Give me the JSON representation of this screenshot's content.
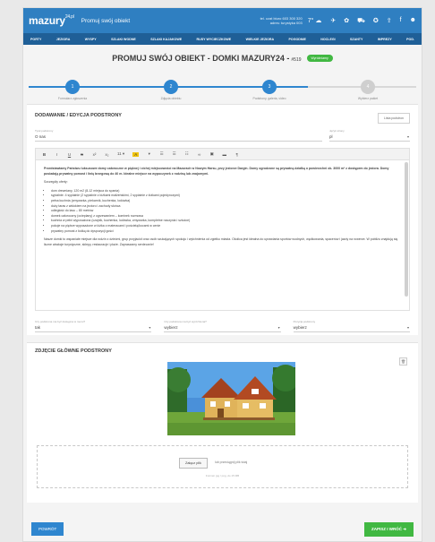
{
  "header": {
    "logo": "mazury",
    "logo_suffix": "24.pl",
    "tagline": "Promuj swój obiekt",
    "contact_line1": "tel. czat biuro 603 300 320",
    "contact_line2": "adres: turystyka 003",
    "weather": "7° ☁",
    "icons": [
      "plane-icon",
      "paw-icon",
      "car-icon",
      "settings-icon",
      "share-icon",
      "facebook-icon",
      "user-icon"
    ]
  },
  "nav": [
    "PORTY",
    "JEZIORA",
    "WYSPY",
    "SZLAKI WODNE",
    "SZLAKI KAJAKOWE",
    "RUSY WYCIECZKOWE",
    "WIELKIE JEZIORA",
    "POGODNIE",
    "NOCLEGI",
    "SZANTY",
    "IMPREZY",
    "POD."
  ],
  "page": {
    "title": "PROMUJ SWÓJ OBIEKT - DOMKI MAZURY24 -",
    "id": "#519",
    "badge": "Wyróżniamy"
  },
  "steps": [
    {
      "number": "1",
      "label": "Formularz zgłoszenia",
      "active": true
    },
    {
      "number": "2",
      "label": "Zdjęcia obiektu",
      "active": true
    },
    {
      "number": "3",
      "label": "Podstrony, galeria, video",
      "active": true
    },
    {
      "number": "4",
      "label": "Wybierz pakiet",
      "active": false
    }
  ],
  "progress": 0.72,
  "section1": {
    "title": "DODAWANIE / EDYCJA PODSTRONY",
    "list_button": "Lista podstron",
    "title_field_label": "Tytuł podstrony",
    "title_field_value": "O nas",
    "lang_label": "Język strony",
    "lang_value": "pl",
    "toolbar": [
      "B",
      "I",
      "U",
      "S",
      "x²",
      "x₂",
      "11 ▾",
      "A",
      "▾",
      "☰",
      "☰",
      "☷",
      "∞",
      "▣",
      "▬",
      "¶"
    ],
    "editor": {
      "p1": "Przedstawiamy Państwu luksusowe domy całoroczne w pięknej i cichej miejscowości na Mazurach w Nowym Harsu, przy jeziorze Dargin. Domy ogrodzone są prywatną działką o powierzchni ok. 3000 m² z dostępem do jeziora. Domy posiadają prywatny pomost i linię brzegową do 40 m. Idealne miejsce na wypoczynek z rodziną lub znajomymi.",
      "heading": "Szczegóły oferty:",
      "items": [
        "dom drewniany, 120 m2 (8-12 miejsca do spania)",
        "sypialnie: 4 sypialnie (2 sypialnie z łóżkami małżeńskimi, 2 sypialnie z łóżkami pojedynczymi)",
        "pełna kuchnia (zmywarka, piekarnik, kuchenka, lodówka)",
        "duży taras z widokiem na jezioro i zachody słońca",
        "odległość do lasu – 80 metrów",
        "domek całoroczny (ocieplany) z ogrzewaniem – kominek rozmowa",
        "kuchnia w pełni wyposażona (czajnik, kuchenka, lodówka, zmywarka, kompletne naczynia i sztućce)",
        "pokoje na piętrze wyposażone w łóżka z materacami i pościelą/kocami w cenie",
        "prywatny pomost z łódką do dyspozycji gości"
      ],
      "p2": "Nasze domki to wspaniałe miejsce dla rodzin z dziećmi, grup przyjaciół oraz osób szukających spokoju i wytchnienia od zgiełku miasta. Okolica jest idealna do uprawiania sportów wodnych, wędkowania, spacerów i jazdy na rowerze. W pobliżu znajdują się liczne atrakcje turystyczne, sklepy, restauracje i plaże. Zapraszamy serdecznie!"
    },
    "select1_label": "Czy podstrona ma być dostępna w menu?",
    "select1_value": "tak",
    "select2_label": "Czy podstrona ma być wyróżniona?",
    "select2_value": "wybierz",
    "select3_label": "Pozycja podstrony",
    "select3_value": "wybierz"
  },
  "section2": {
    "title": "ZDJĘCIE GŁÓWNE PODSTRONY",
    "trash_icon": "trash-icon",
    "upload_button": "Załącz plik",
    "upload_hint": "lub przeciągnij plik tutaj",
    "upload_sub": "Format: jpg / png, do 15 MB"
  },
  "footer": {
    "back": "POWRÓT",
    "save": "ZAPISZ I WRÓĆ  ➜"
  }
}
